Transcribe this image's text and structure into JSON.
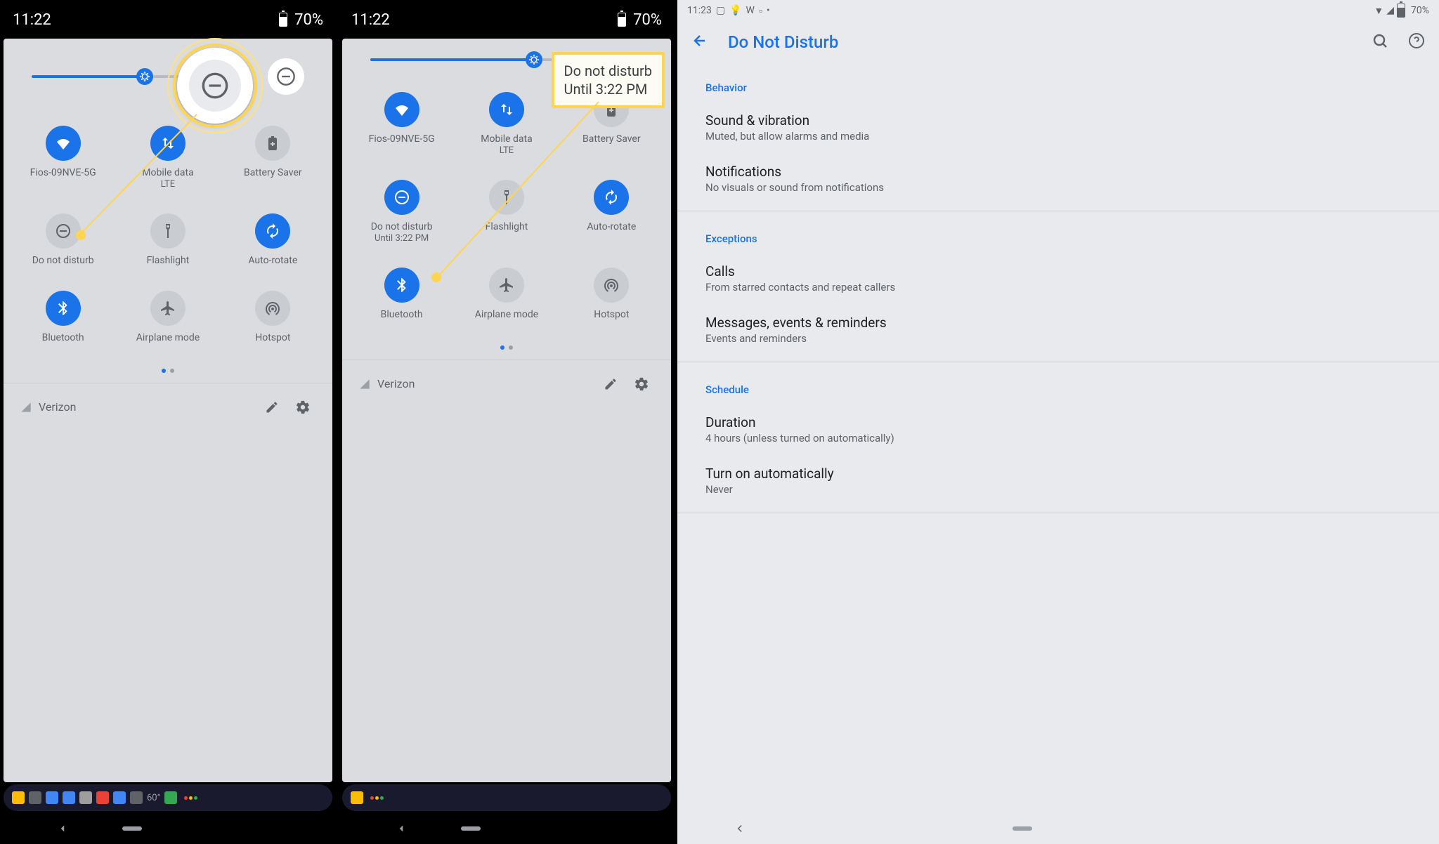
{
  "statusbar12": {
    "time": "11:22",
    "battery": "70%"
  },
  "statusbar3": {
    "time": "11:23",
    "battery": "70%"
  },
  "qs": {
    "wifi": "Fios-09NVE-5G",
    "mobile_data": "Mobile data",
    "mobile_sub": "LTE",
    "battery_saver": "Battery Saver",
    "dnd": "Do not disturb",
    "dnd_sub": "Until 3:22 PM",
    "flashlight": "Flashlight",
    "autorotate": "Auto-rotate",
    "bluetooth": "Bluetooth",
    "airplane": "Airplane mode",
    "hotspot": "Hotspot",
    "carrier": "Verizon"
  },
  "notif_temp": "60°",
  "callout": {
    "line1": "Do not disturb",
    "line2": "Until 3:22 PM"
  },
  "settings": {
    "title": "Do Not Disturb",
    "behavior": {
      "header": "Behavior",
      "sound_title": "Sound & vibration",
      "sound_sub": "Muted, but allow alarms and media",
      "notif_title": "Notifications",
      "notif_sub": "No visuals or sound from notifications"
    },
    "exceptions": {
      "header": "Exceptions",
      "calls_title": "Calls",
      "calls_sub": "From starred contacts and repeat callers",
      "msgs_title": "Messages, events & reminders",
      "msgs_sub": "Events and reminders"
    },
    "schedule": {
      "header": "Schedule",
      "duration_title": "Duration",
      "duration_sub": "4 hours (unless turned on automatically)",
      "auto_title": "Turn on automatically",
      "auto_sub": "Never"
    }
  }
}
